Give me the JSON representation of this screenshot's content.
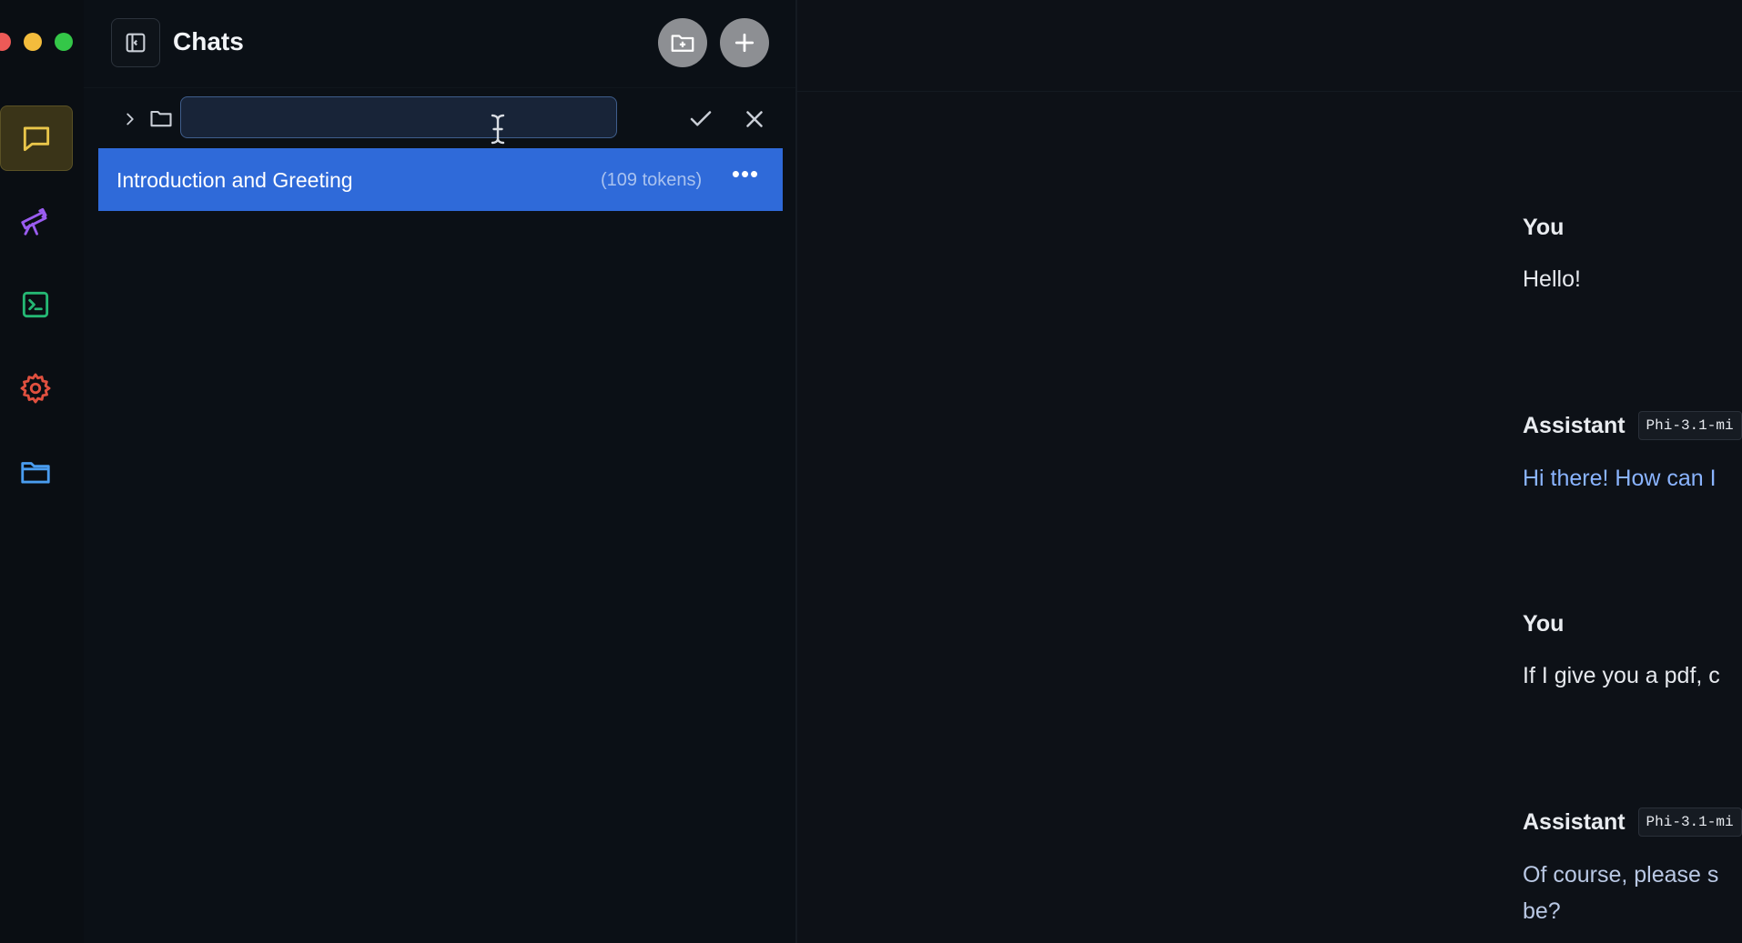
{
  "window": {
    "traffic_lights": [
      "close",
      "minimize",
      "maximize"
    ]
  },
  "rail": {
    "items": [
      {
        "name": "chats",
        "icon": "chat-bubble-icon",
        "color": "#e9c64a",
        "active": true
      },
      {
        "name": "discover",
        "icon": "telescope-icon",
        "color": "#9a5cf0"
      },
      {
        "name": "terminal",
        "icon": "terminal-icon",
        "color": "#25b874"
      },
      {
        "name": "settings",
        "icon": "gear-icon",
        "color": "#e0503f"
      },
      {
        "name": "files",
        "icon": "folder-icon",
        "color": "#4a9df0"
      }
    ]
  },
  "chats_panel": {
    "title": "Chats",
    "new_folder_icon": "new-folder-icon",
    "new_chat_icon": "plus-icon",
    "folder_name_input": {
      "value": "",
      "placeholder": ""
    },
    "items": [
      {
        "title": "Introduction and Greeting",
        "tokens": "(109 tokens)",
        "more": "•••"
      }
    ]
  },
  "conversation": {
    "messages": [
      {
        "role": "You",
        "text": "Hello!"
      },
      {
        "role": "Assistant",
        "model": "Phi-3.1-mi",
        "text": "Hi there! How can I"
      },
      {
        "role": "You",
        "text": "If I give you a pdf, c"
      },
      {
        "role": "Assistant",
        "model": "Phi-3.1-mi",
        "text": "Of course, please s",
        "text2": "be?"
      }
    ]
  },
  "colors": {
    "accent_selected": "#2f6ad9",
    "background": "#0b1016"
  }
}
